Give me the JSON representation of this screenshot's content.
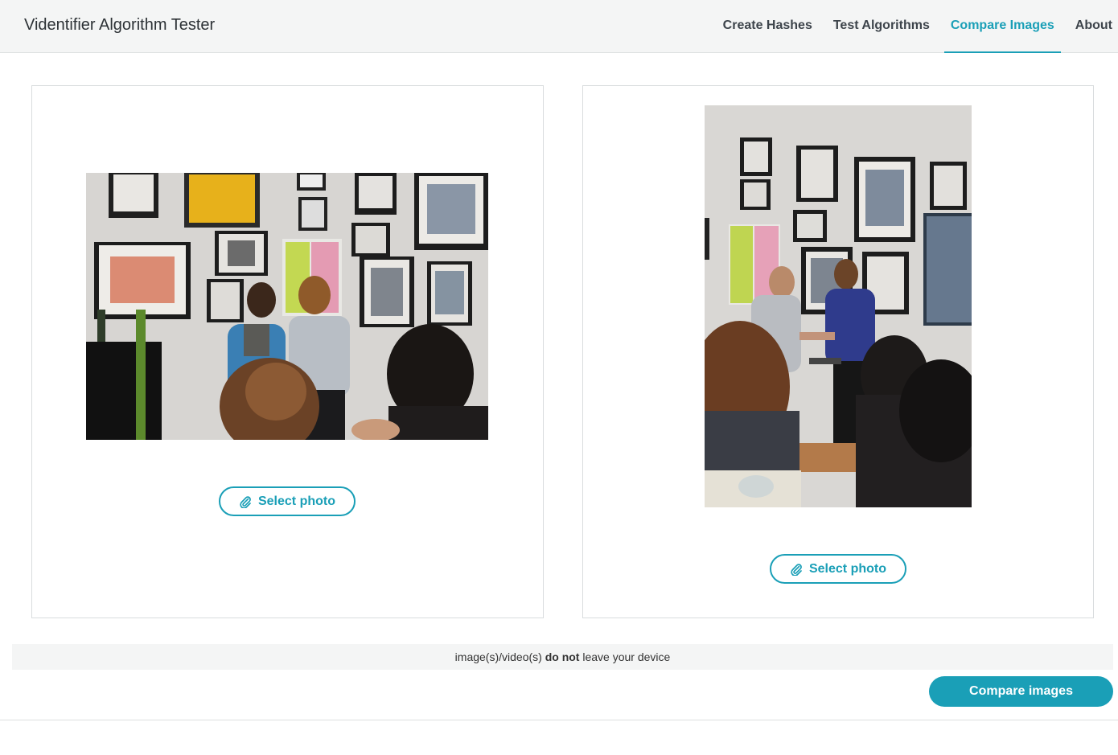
{
  "app": {
    "title": "Videntifier Algorithm Tester"
  },
  "nav": {
    "items": [
      {
        "label": "Create Hashes",
        "active": false
      },
      {
        "label": "Test Algorithms",
        "active": false
      },
      {
        "label": "Compare Images",
        "active": true
      },
      {
        "label": "About",
        "active": false
      }
    ]
  },
  "left_panel": {
    "image": {
      "alt": "Two women speaking in front of a wall of framed photos"
    },
    "select_label": "Select photo",
    "select_icon": "paperclip-icon"
  },
  "right_panel": {
    "image": {
      "alt": "Two men shaking hands in front of a wall of framed photos"
    },
    "select_label": "Select photo",
    "select_icon": "paperclip-icon"
  },
  "notice": {
    "prefix": "image(s)/video(s)",
    "emphasis": "do not",
    "suffix": "leave your device"
  },
  "actions": {
    "compare_label": "Compare images"
  },
  "colors": {
    "accent": "#1a9fb7",
    "bar_bg": "#f4f5f5",
    "text_dark": "#2d3236"
  }
}
